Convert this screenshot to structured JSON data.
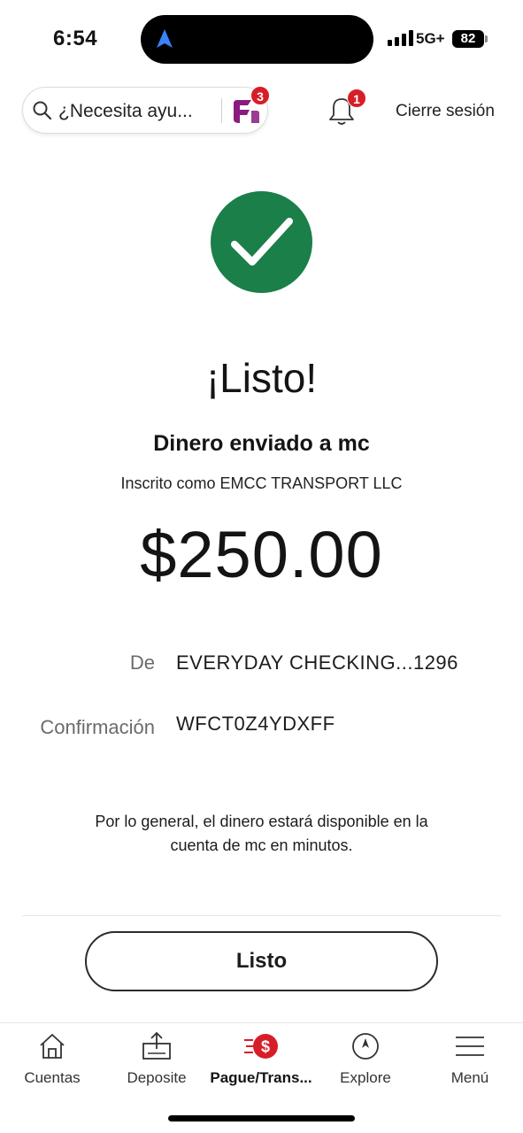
{
  "status_bar": {
    "time": "6:54",
    "network": "5G+",
    "battery": "82"
  },
  "header": {
    "help_placeholder": "¿Necesita ayu...",
    "help_badge": "3",
    "notifications_badge": "1",
    "signout_label": "Cierre sesión"
  },
  "confirmation": {
    "title": "¡Listo!",
    "subtitle": "Dinero enviado a mc",
    "enrolled": "Inscrito como EMCC TRANSPORT LLC",
    "amount": "$250.00",
    "from_label": "De",
    "from_value": "EVERYDAY CHECKING...1296",
    "confirmation_label": "Confirmación",
    "confirmation_value": "WFCT0Z4YDXFF",
    "note": "Por lo general, el dinero estará disponible en la cuenta de mc en minutos.",
    "done_label": "Listo"
  },
  "bottom_nav": {
    "items": [
      {
        "label": "Cuentas",
        "icon": "home-icon"
      },
      {
        "label": "Deposite",
        "icon": "deposit-icon"
      },
      {
        "label": "Pague/Trans...",
        "icon": "pay-transfer-icon",
        "active": true
      },
      {
        "label": "Explore",
        "icon": "compass-icon"
      },
      {
        "label": "Menú",
        "icon": "menu-icon"
      }
    ]
  },
  "colors": {
    "success_green": "#1a7f48",
    "badge_red": "#d71e28",
    "fargo_purple": "#8a1b7f"
  }
}
